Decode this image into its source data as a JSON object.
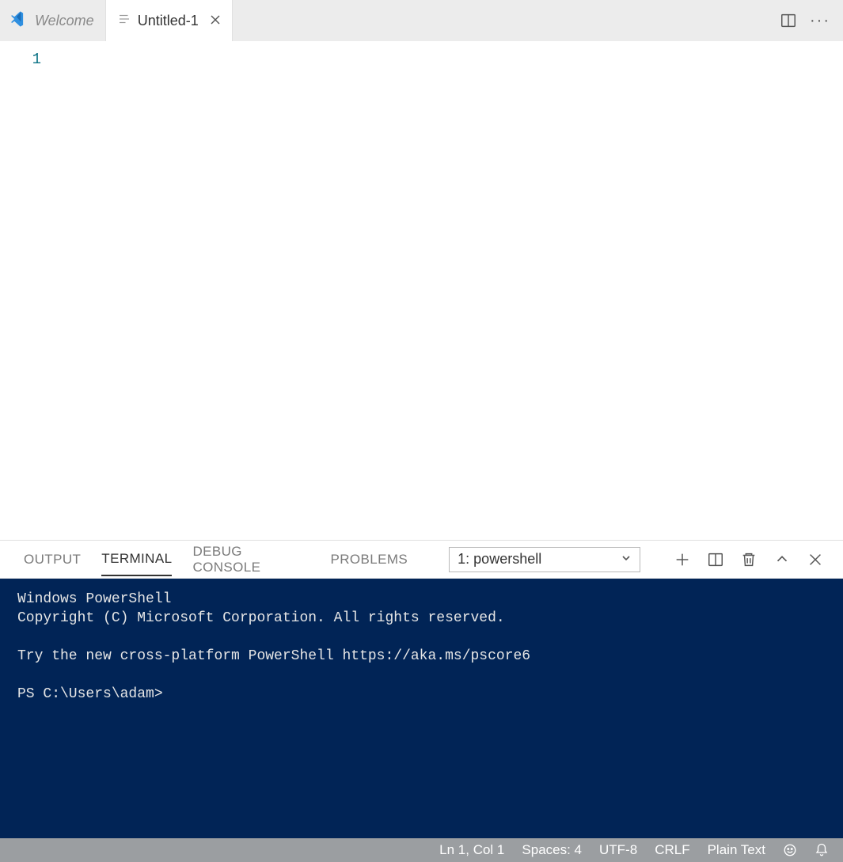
{
  "tabs": {
    "welcome": {
      "label": "Welcome"
    },
    "untitled": {
      "label": "Untitled-1"
    }
  },
  "editor": {
    "line_number": "1"
  },
  "panel": {
    "tabs": {
      "output": "OUTPUT",
      "terminal": "TERMINAL",
      "debug": "DEBUG CONSOLE",
      "problems": "PROBLEMS"
    },
    "terminal_select": "1: powershell",
    "terminal_lines": {
      "l1": "Windows PowerShell",
      "l2": "Copyright (C) Microsoft Corporation. All rights reserved.",
      "l3": "",
      "l4": "Try the new cross-platform PowerShell https://aka.ms/pscore6",
      "l5": "",
      "l6": "PS C:\\Users\\adam>"
    }
  },
  "statusbar": {
    "ln_col": "Ln 1, Col 1",
    "spaces": "Spaces: 4",
    "encoding": "UTF-8",
    "eol": "CRLF",
    "language": "Plain Text"
  }
}
